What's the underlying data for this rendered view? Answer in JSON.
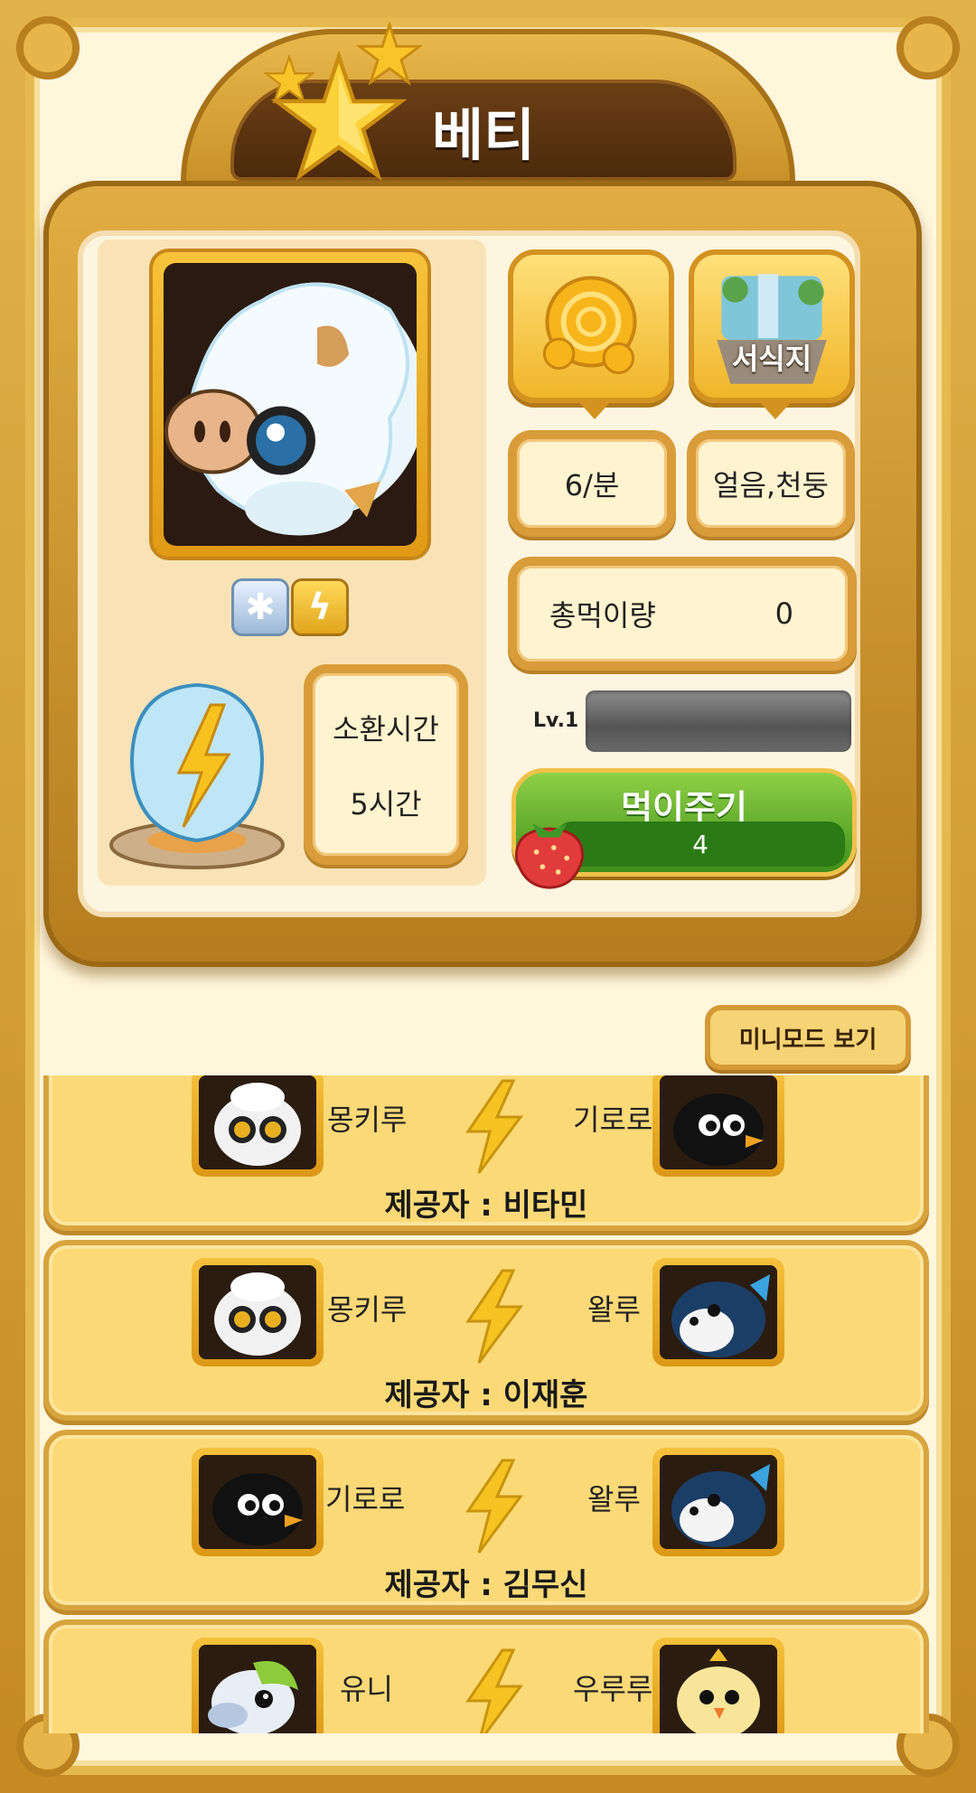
{
  "pet": {
    "name": "베티",
    "rate": "6/분",
    "elements_text": "얼음,천둥",
    "element_icons": [
      "snowflake-icon",
      "lightning-icon"
    ],
    "total_food_label": "총먹이량",
    "total_food_value": "0",
    "summon_label": "소환시간",
    "summon_value": "5시간",
    "level_label": "Lv.1",
    "level_progress": 0,
    "habitat_label": "서식지"
  },
  "feed": {
    "label": "먹이주기",
    "count": "4"
  },
  "mini_mode_label": "미니모드 보기",
  "combos": [
    {
      "left_name": "몽키루",
      "right_name": "기로로",
      "provider": "제공자 : 비타민"
    },
    {
      "left_name": "몽키루",
      "right_name": "왈루",
      "provider": "제공자 : 이재훈"
    },
    {
      "left_name": "기로로",
      "right_name": "왈루",
      "provider": "제공자 : 김무신"
    },
    {
      "left_name": "유니",
      "right_name": "우루루",
      "provider": ""
    }
  ],
  "colors": {
    "frame": "#c9902a",
    "panel": "#fdf5df",
    "accent_green": "#3f8f1a",
    "combo_bg": "#fbd977"
  }
}
